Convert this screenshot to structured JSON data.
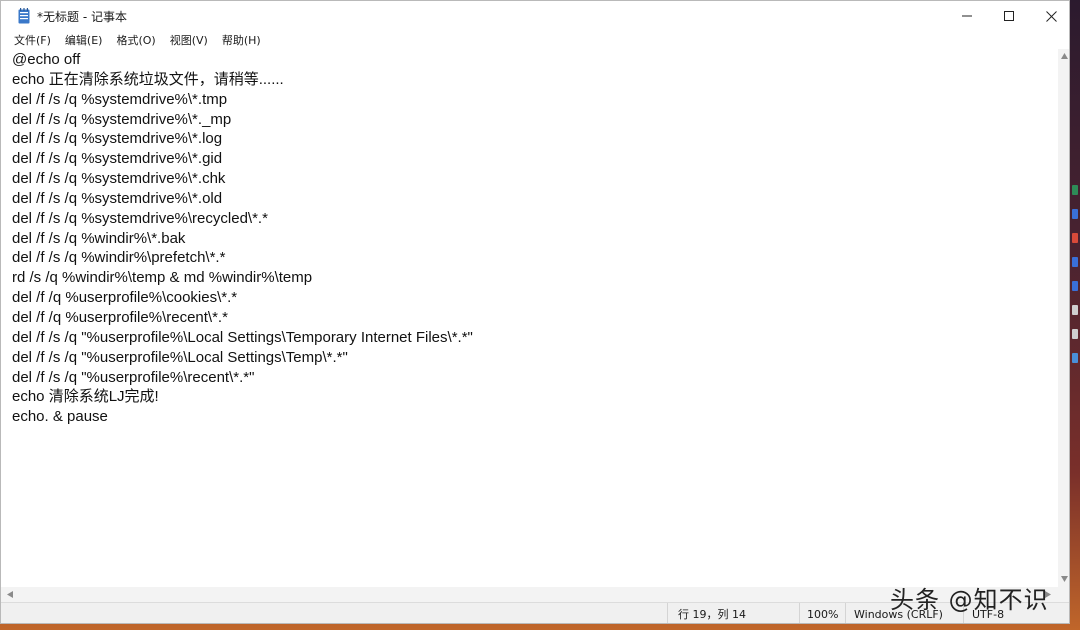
{
  "window": {
    "title": "*无标题 - 记事本"
  },
  "menu": {
    "items": [
      {
        "label": "文件(F)"
      },
      {
        "label": "编辑(E)"
      },
      {
        "label": "格式(O)"
      },
      {
        "label": "视图(V)"
      },
      {
        "label": "帮助(H)"
      }
    ]
  },
  "editor": {
    "content": "@echo off\necho 正在清除系统垃圾文件，请稍等......\ndel /f /s /q %systemdrive%\\*.tmp\ndel /f /s /q %systemdrive%\\*._mp\ndel /f /s /q %systemdrive%\\*.log\ndel /f /s /q %systemdrive%\\*.gid\ndel /f /s /q %systemdrive%\\*.chk\ndel /f /s /q %systemdrive%\\*.old\ndel /f /s /q %systemdrive%\\recycled\\*.*\ndel /f /s /q %windir%\\*.bak\ndel /f /s /q %windir%\\prefetch\\*.*\nrd /s /q %windir%\\temp & md %windir%\\temp\ndel /f /q %userprofile%\\cookies\\*.*\ndel /f /q %userprofile%\\recent\\*.*\ndel /f /s /q \"%userprofile%\\Local Settings\\Temporary Internet Files\\*.*\"\ndel /f /s /q \"%userprofile%\\Local Settings\\Temp\\*.*\"\ndel /f /s /q \"%userprofile%\\recent\\*.*\"\necho 清除系统LJ完成!\necho. & pause"
  },
  "status": {
    "position": "行 19，列 14",
    "zoom": "100%",
    "line_ending": "Windows (CRLF)",
    "encoding": "UTF-8"
  },
  "watermark": {
    "text": "头条 @知不识"
  },
  "colors": {
    "accent_icon": "#3a78c9",
    "desktop_bottom": "#c0662a"
  },
  "icons": {
    "app": "notepad-icon",
    "minimize": "minimize-icon",
    "maximize": "maximize-icon",
    "close": "close-icon"
  }
}
